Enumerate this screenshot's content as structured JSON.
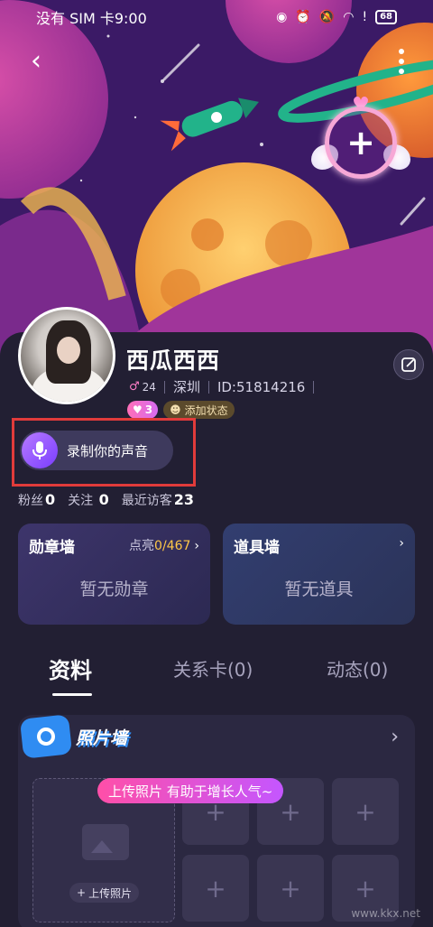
{
  "status_bar": {
    "carrier_time": "没有 SIM 卡9:00",
    "battery": "68",
    "icons": [
      "eye-icon",
      "alarm-icon",
      "mute-icon",
      "wifi-icon",
      "alert-icon",
      "battery-icon"
    ]
  },
  "header": {
    "back_icon": "back-arrow-icon",
    "more_icon": "more-vertical-icon",
    "add_avatar_frame_symbol": "+"
  },
  "profile": {
    "nickname": "西瓜西西",
    "gender_symbol": "♂",
    "age": "24",
    "city": "深圳",
    "id": "ID:51814216",
    "heart_count": "3",
    "add_status_label": "添加状态",
    "record_voice_label": "录制你的声音"
  },
  "stats": [
    {
      "label": "粉丝",
      "value": "0"
    },
    {
      "label": "关注",
      "value": "0"
    },
    {
      "label": "最近访客",
      "value": "23"
    }
  ],
  "cards": {
    "badge": {
      "title": "勋章墙",
      "lit_label": "点亮",
      "lit_value": "0/467",
      "empty": "暂无勋章"
    },
    "props": {
      "title": "道具墙",
      "empty": "暂无道具"
    }
  },
  "tabs": [
    {
      "label": "资料",
      "active": true
    },
    {
      "label": "关系卡(0)",
      "active": false
    },
    {
      "label": "动态(0)",
      "active": false
    }
  ],
  "photo_wall": {
    "title": "照片墙",
    "tip": "上传照片 有助于增长人气~",
    "upload_label": "上传照片",
    "slot_symbol": "+"
  },
  "watermark": "www.kkx.net",
  "colors": {
    "accent_pink": "#ff4fa8",
    "accent_purple": "#7a3dff",
    "highlight_red": "#e13b3b",
    "badge_lit": "#ffc847",
    "photo_blue": "#2f8cf2"
  }
}
